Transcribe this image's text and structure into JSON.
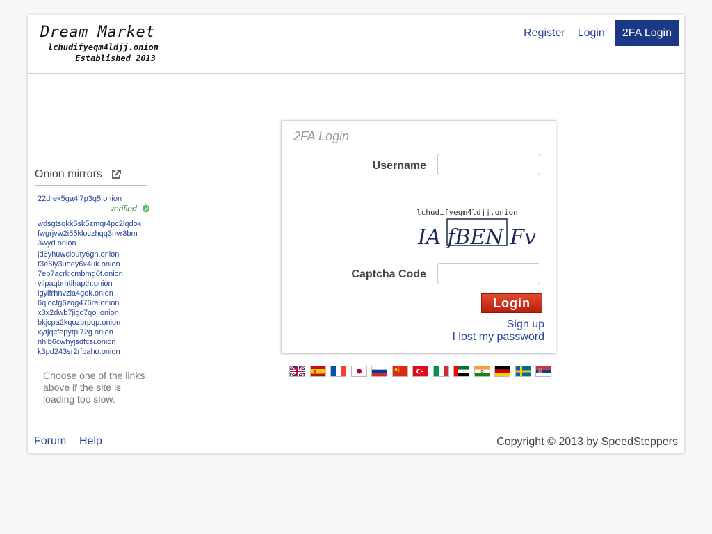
{
  "header": {
    "logo_title": "Dream Market",
    "logo_onion": "lchudifyeqm4ldjj.onion",
    "logo_established": "Established 2013",
    "nav": [
      "Register",
      "Login",
      "2FA Login"
    ]
  },
  "sidebar": {
    "title": "Onion mirrors",
    "verified_label": "verified",
    "mirrors": [
      "22drek5ga4l7p3q5.onion",
      "wdsgtsqkk5sk5zmqr4pc2lqdox",
      "fwgrjvw2i55kloczhqq3nvr3bm",
      "3wyd.onion",
      "jd6yhuwciouty6gn.onion",
      "t3e6ly3uoey6x4uk.onion",
      "7ep7acrklcmbmg6t.onion",
      "vilpaqbrntihapth.onion",
      "igyifrhnvzla4gok.onion",
      "6qlocfg6zqg476re.onion",
      "x3x2dwb7jigc7qoj.onion",
      "bkjcpa2kqozbrpqp.onion",
      "xytjqcfepytpi72g.onion",
      "nhib6cwhyjsdfcsi.onion",
      "k3pd243sr2rfbaho.onion"
    ],
    "note": "Choose one of the links above if the site is loading too slow."
  },
  "login": {
    "title": "2FA Login",
    "username_label": "Username",
    "username_value": "",
    "captcha_onion": "lchudifyeqm4ldjj.onion",
    "captcha_text": "IA fBEN Fv",
    "captcha_label": "Captcha Code",
    "captcha_value": "",
    "button_label": "Login",
    "signup_link": "Sign up",
    "lost_password_link": "I lost my password"
  },
  "languages": [
    "english-flag",
    "spanish-flag",
    "french-flag",
    "japanese-flag",
    "russian-flag",
    "chinese-flag",
    "turkish-flag",
    "italian-flag",
    "uae-flag",
    "indian-flag",
    "german-flag",
    "swedish-flag",
    "serbian-flag"
  ],
  "footer": {
    "links": [
      "Forum",
      "Help"
    ],
    "copyright": "Copyright © 2013 by SpeedSteppers"
  },
  "colors": {
    "link": "#26459c",
    "nav_active_bg": "#1a3885",
    "button_red": "#c8321c",
    "verified_green": "#2e8b2e"
  }
}
